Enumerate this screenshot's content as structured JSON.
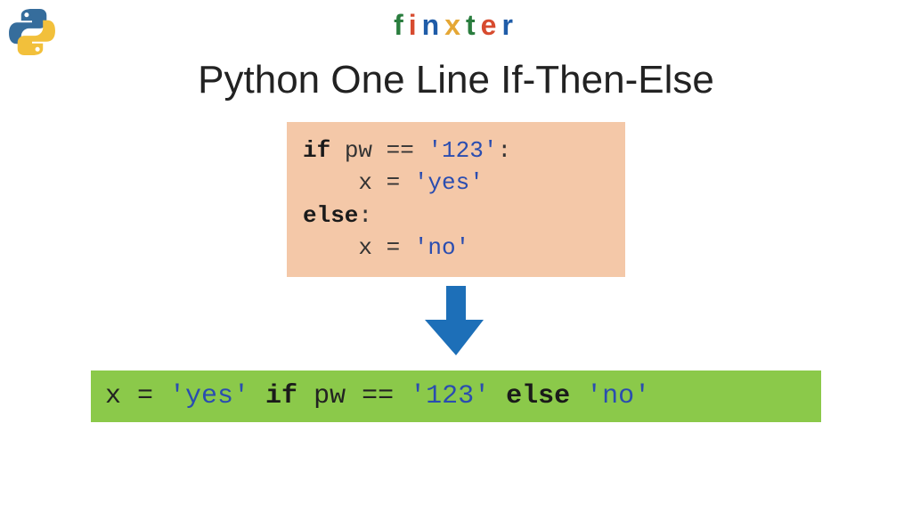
{
  "brand": {
    "letters": [
      "f",
      "i",
      "n",
      "x",
      "t",
      "e",
      "r"
    ]
  },
  "title": "Python One Line If-Then-Else",
  "code_multi": {
    "line1_kw": "if",
    "line1_rest1": " pw == ",
    "line1_str": "'123'",
    "line1_colon": ":",
    "line2_indent": "    x = ",
    "line2_str": "'yes'",
    "line3_kw": "else",
    "line3_colon": ":",
    "line4_indent": "    x = ",
    "line4_str": "'no'"
  },
  "code_one": {
    "part1": "x = ",
    "str1": "'yes'",
    "space1": " ",
    "kw1": "if",
    "part2": " pw == ",
    "str2": "'123'",
    "space2": " ",
    "kw2": "else",
    "space3": " ",
    "str3": "'no'"
  },
  "colors": {
    "multi_bg": "#f4c8a8",
    "one_bg": "#8bc94a",
    "arrow": "#1d6fb8"
  }
}
